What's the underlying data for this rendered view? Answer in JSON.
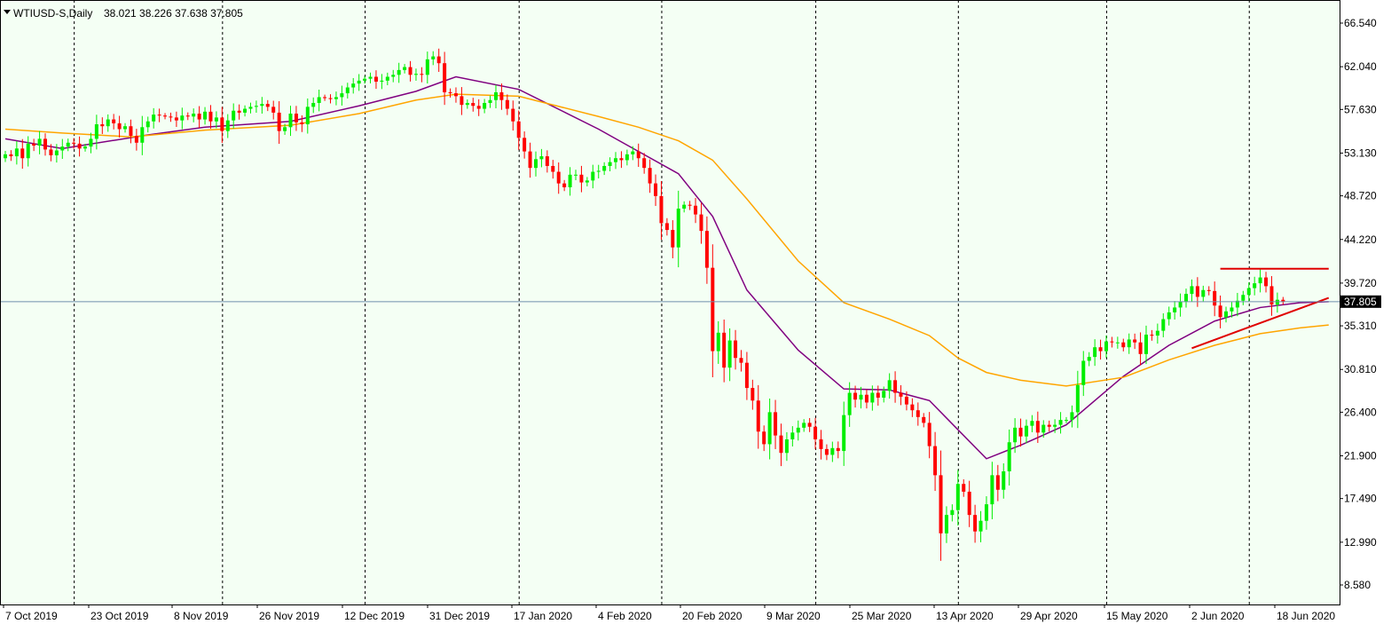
{
  "header": {
    "symbol": "WTIUSD-S,Daily",
    "ohlc": "38.021 38.226 37.638 37.805"
  },
  "colors": {
    "background": "#f4fff4",
    "bull_candle": "#00ee00",
    "bear_candle": "#ff0000",
    "ma_fast": "#800080",
    "ma_slow": "#ffa500",
    "trendlines": "#e00000",
    "price_line": "#6f8fad",
    "price_label_bg": "#000000",
    "price_label_fg": "#ffffff"
  },
  "chart_data": {
    "type": "candlestick",
    "instrument": "WTIUSD-S",
    "timeframe": "Daily",
    "ylim": [
      6.5,
      68.5
    ],
    "yticks": [
      "66.540",
      "62.040",
      "57.630",
      "53.130",
      "48.720",
      "44.220",
      "39.720",
      "35.310",
      "30.810",
      "26.400",
      "21.900",
      "17.490",
      "12.990",
      "8.580"
    ],
    "xticks": [
      "7 Oct 2019",
      "23 Oct 2019",
      "8 Nov 2019",
      "26 Nov 2019",
      "12 Dec 2019",
      "31 Dec 2019",
      "17 Jan 2020",
      "4 Feb 2020",
      "20 Feb 2020",
      "9 Mar 2020",
      "25 Mar 2020",
      "13 Apr 2020",
      "29 Apr 2020",
      "15 May 2020",
      "2 Jun 2020",
      "18 Jun 2020"
    ],
    "grid": "vertical dashed",
    "current_price": "37.805",
    "closes": [
      53.0,
      52.8,
      53.6,
      52.6,
      54.1,
      53.9,
      54.6,
      53.5,
      52.9,
      53.4,
      53.8,
      54.2,
      54.1,
      53.6,
      53.8,
      54.6,
      56.1,
      55.9,
      56.6,
      56.2,
      55.6,
      55.9,
      54.9,
      54.2,
      55.8,
      56.4,
      57.1,
      57.0,
      56.9,
      56.8,
      56.5,
      57.0,
      56.9,
      57.2,
      56.6,
      57.4,
      56.4,
      56.8,
      55.4,
      56.5,
      57.5,
      57.3,
      57.7,
      57.9,
      58.0,
      58.2,
      57.9,
      57.3,
      55.4,
      55.8,
      57.2,
      56.3,
      56.1,
      57.9,
      58.3,
      58.9,
      58.8,
      58.7,
      58.9,
      59.3,
      59.9,
      60.3,
      60.6,
      60.8,
      61.0,
      60.5,
      60.6,
      61.0,
      61.2,
      61.7,
      62.0,
      61.2,
      61.3,
      61.2,
      62.8,
      63.1,
      62.4,
      59.4,
      59.3,
      59.0,
      58.1,
      58.3,
      58.0,
      57.7,
      58.3,
      58.6,
      59.4,
      58.6,
      57.7,
      56.4,
      54.7,
      53.3,
      51.6,
      52.5,
      52.8,
      51.8,
      51.2,
      50.0,
      49.6,
      50.9,
      50.9,
      50.1,
      50.3,
      51.2,
      51.3,
      51.8,
      52.2,
      52.6,
      52.4,
      53.0,
      53.3,
      52.6,
      51.6,
      50.0,
      48.7,
      45.9,
      45.2,
      43.4,
      47.4,
      47.8,
      47.7,
      46.8,
      45.1,
      41.3,
      32.7,
      34.6,
      31.0,
      33.8,
      32.0,
      31.5,
      28.9,
      27.6,
      24.4,
      23.1,
      26.4,
      24.0,
      22.2,
      23.6,
      24.3,
      24.8,
      25.3,
      24.9,
      23.6,
      22.6,
      22.0,
      22.7,
      22.4,
      26.1,
      28.4,
      27.7,
      28.2,
      27.4,
      28.4,
      27.9,
      28.6,
      29.7,
      28.4,
      28.0,
      27.2,
      26.6,
      25.9,
      25.3,
      22.9,
      19.9,
      13.9,
      15.8,
      16.3,
      19.0,
      18.2,
      15.8,
      14.1,
      15.2,
      16.9,
      19.9,
      18.4,
      20.3,
      23.3,
      24.8,
      23.9,
      25.0,
      25.5,
      24.3,
      25.1,
      24.9,
      25.1,
      25.6,
      25.6,
      26.4,
      29.2,
      31.7,
      32.1,
      33.1,
      32.7,
      33.7,
      33.6,
      33.6,
      33.1,
      33.9,
      33.6,
      32.4,
      34.4,
      34.3,
      34.8,
      36.0,
      36.7,
      37.2,
      37.8,
      38.6,
      39.4,
      38.3,
      39.0,
      38.9,
      37.4,
      36.2,
      36.8,
      37.2,
      37.9,
      38.5,
      39.2,
      39.7,
      40.3,
      39.4,
      37.5,
      38.0,
      37.8
    ],
    "series": [
      {
        "name": "MA fast (purple)",
        "x_index": [
          0,
          10,
          25,
          35,
          50,
          62,
          72,
          79,
          90,
          104,
          111,
          118,
          124,
          130,
          139,
          147,
          155,
          162,
          167,
          172,
          178,
          186,
          196,
          204,
          212,
          220,
          227,
          232
        ],
        "values": [
          54.6,
          53.6,
          55.0,
          55.8,
          56.4,
          58.0,
          59.5,
          61.0,
          59.7,
          55.6,
          53.3,
          51.0,
          46.6,
          39.0,
          32.8,
          28.8,
          28.7,
          27.6,
          24.6,
          21.6,
          23.0,
          25.1,
          30.1,
          33.3,
          35.8,
          37.2,
          37.7,
          37.8
        ]
      },
      {
        "name": "MA slow (orange)",
        "x_index": [
          0,
          10,
          22,
          35,
          50,
          62,
          72,
          79,
          90,
          104,
          111,
          118,
          124,
          130,
          139,
          147,
          155,
          162,
          167,
          172,
          178,
          186,
          196,
          204,
          212,
          220,
          227,
          232
        ],
        "values": [
          55.6,
          55.2,
          54.8,
          55.5,
          56.0,
          57.2,
          58.6,
          59.2,
          59.0,
          56.9,
          55.8,
          54.4,
          52.4,
          48.4,
          42.0,
          37.7,
          36.0,
          34.3,
          32.0,
          30.5,
          29.7,
          29.1,
          30.0,
          31.8,
          33.3,
          34.5,
          35.1,
          35.4
        ]
      }
    ],
    "trendlines": [
      {
        "name": "resistance",
        "x_index": [
          213,
          232
        ],
        "values": [
          41.2,
          41.2
        ]
      },
      {
        "name": "rising support",
        "x_index": [
          208,
          232
        ],
        "values": [
          33.0,
          38.2
        ]
      }
    ]
  }
}
